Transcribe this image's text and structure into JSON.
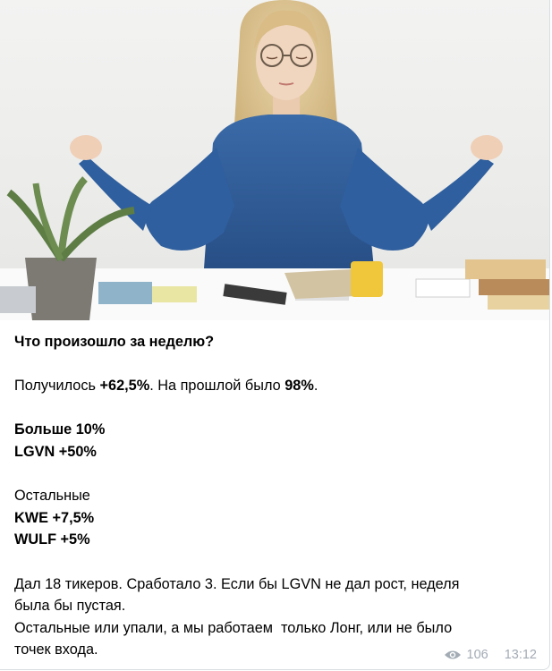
{
  "post": {
    "title": "Что произошло за неделю?",
    "result_prefix": "Получилось ",
    "result_value": "+62,5%",
    "result_mid": ". На прошлой было ",
    "prev_value": "98%",
    "result_suffix": ".",
    "section1_title": "Больше 10%",
    "section1_item": "LGVN +50%",
    "section2_title": "Остальные",
    "section2_items": [
      "KWE +7,5%",
      "WULF +5%"
    ],
    "summary_lines": [
      "Дал 18 тикеров. Сработало 3. Если бы LGVN не дал рост, неделя",
      "была бы пустая.",
      "Остальные или упали, а мы работаем  только Лонг, или не было",
      "точек входа."
    ]
  },
  "meta": {
    "icon": "eye-icon",
    "views": "106",
    "time": "13:12"
  },
  "colors": {
    "meta": "#a3abb4",
    "sweater": "#2f5f9e",
    "background": "#ffffff"
  }
}
